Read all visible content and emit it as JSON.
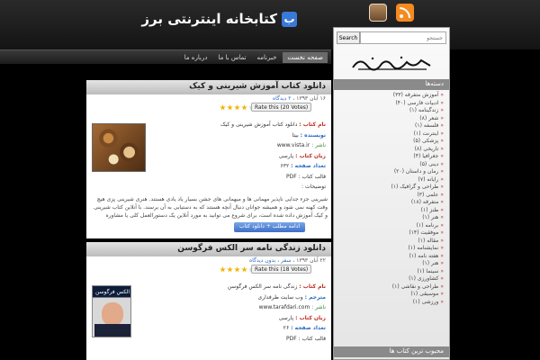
{
  "header": {
    "site_title": "کتابخانه اینترنتی برز",
    "logo_letter": "ب",
    "icons": [
      "instagram-icon",
      "rss-icon"
    ]
  },
  "nav": {
    "items": [
      "صفحه نخست",
      "خبرنامه",
      "تماس با ما",
      "درباره ما"
    ]
  },
  "sidebar": {
    "search_placeholder": "جستجو",
    "search_button": "Search",
    "categories_title": "دسته‌ها",
    "categories": [
      "آموزش متفرقه (۳۳)",
      "ادبیات فارسی (۴۰)",
      "زندگینامه (۱)",
      "شعر (۸)",
      "فلسفه (۱)",
      "اینترنت (۱)",
      "پزشکی (۵)",
      "تاریخی (۸)",
      "جغرافیا (۴)",
      "دینی (۵)",
      "رمان و داستان (۲۰)",
      "رایانه (۷)",
      "طراحی و گرافیک (۱)",
      "علمی (۳)",
      "متفرقه (۱۸)",
      "طنز (۱)",
      "هنر (۱)",
      "برنامه (۱)",
      "موفقیت (۱۴)",
      "مقاله (۱)",
      "نمایشنامه (۱)",
      "هفته نامه (۱)",
      "هنر (۱)",
      "سینما (۱)",
      "کشاورزی (۱)",
      "طراحی و نقاشی (۱)",
      "موسیقی (۱)",
      "ورزشی (۱)"
    ],
    "popular_title": "محبوب ترین کتاب ها"
  },
  "posts": [
    {
      "title": "دانلود کتاب آموزش شیرینی و کیک",
      "date": "۱۶ آبان ۱۳۹۳",
      "comments": "۲ دیدگاه",
      "tag": "",
      "rating_stars": 4,
      "rate_label": "Rate this (20 Votes)",
      "fields": [
        {
          "label": "نام کتاب :",
          "value": "دانلود کتاب آموزش شیرینی و کیک",
          "style": "red"
        },
        {
          "label": "نویسنده :",
          "value": "بیتا",
          "style": "blue"
        },
        {
          "label": "ناشر :",
          "value": "www.vista.ir",
          "style": "green"
        },
        {
          "label": "زبان کتاب :",
          "value": "پارسی",
          "style": "red"
        },
        {
          "label": "تعداد صفحه :",
          "value": "۶۳۲",
          "style": "blue"
        },
        {
          "label": "قالب کتاب :",
          "value": "PDF",
          "style": "plain"
        },
        {
          "label": "توضیحات :",
          "value": "",
          "style": "plain"
        }
      ],
      "description": "شیرینی جزء جدایی ناپذیر مهمانی ها و میهمانی های جشن بسیار یاد یادی هستند. هنری شیرینی پزی هیچ وقت کهنه نمی شود و همیشه جوانان دنبال آنچه هستند که به دستیابی به آن برسند. با آنلاین کتاب شیرینی و کیک آموزش داده شده است، برای شروع می توانید به مورد آنلاین یک دستورالعمل کلی یا مشاوره وصفحه اول و دوم کتاب را مشاهده کنید.",
      "more_label": "ادامه مطلب + دانلود کتاب"
    },
    {
      "title": "دانلود زندگی نامه سر الکس فرگوسن",
      "date": "۲۲ آبان ۱۳۹۳",
      "comments": "بدون دیدگاه",
      "tag": "سفر",
      "rating_stars": 4,
      "rate_label": "Rate this (18 Votes)",
      "cover_text": "الکس فرگوسن",
      "fields": [
        {
          "label": "نام کتاب :",
          "value": "زندگی نامه سر الکس فرگوسن",
          "style": "red"
        },
        {
          "label": "مترجم :",
          "value": "وب سایت طرفداری",
          "style": "blue"
        },
        {
          "label": "ناشر :",
          "value": "www.tarafdari.com",
          "style": "green"
        },
        {
          "label": "زبان کتاب :",
          "value": "پارسی",
          "style": "red"
        },
        {
          "label": "تعداد صفحه :",
          "value": "۲۶",
          "style": "blue"
        },
        {
          "label": "قالب کتاب :",
          "value": "PDF",
          "style": "plain"
        }
      ]
    }
  ]
}
